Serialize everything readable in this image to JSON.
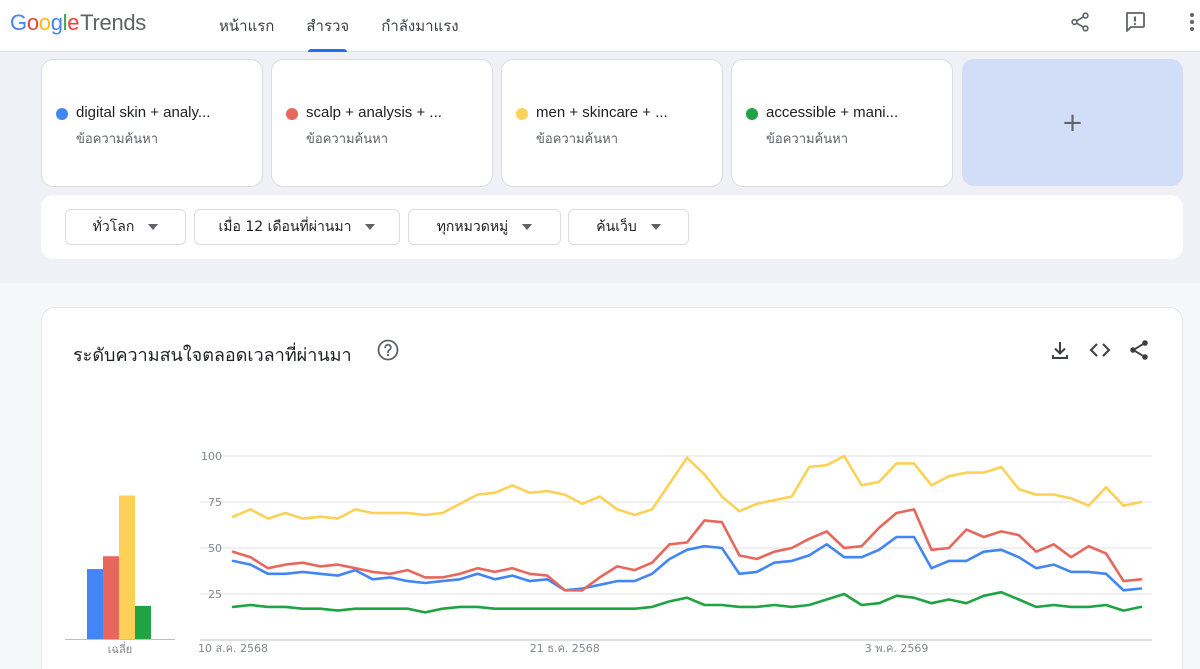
{
  "app": {
    "logo_google": [
      "G",
      "o",
      "o",
      "g",
      "l",
      "e"
    ],
    "logo_trends": "Trends"
  },
  "nav": {
    "tabs": [
      {
        "label": "หน้าแรก",
        "active": false
      },
      {
        "label": "สำรวจ",
        "active": true
      },
      {
        "label": "กำลังมาแรง",
        "active": false
      }
    ]
  },
  "header_icons": [
    "share-icon",
    "feedback-icon",
    "apps-icon"
  ],
  "terms": [
    {
      "name": "digital skin + analy...",
      "type": "ข้อความค้นหา",
      "color": "#4285f4"
    },
    {
      "name": "scalp + analysis + ...",
      "type": "ข้อความค้นหา",
      "color": "#e8675c"
    },
    {
      "name": "men + skincare + ...",
      "type": "ข้อความค้นหา",
      "color": "#fdd158"
    },
    {
      "name": "accessible + mani...",
      "type": "ข้อความค้นหา",
      "color": "#1fa343"
    }
  ],
  "add_term_label": "+",
  "filters": [
    {
      "label": "ทั่วโลก"
    },
    {
      "label": "เมื่อ 12 เดือนที่ผ่านมา"
    },
    {
      "label": "ทุกหมวดหมู่"
    },
    {
      "label": "ค้นเว็บ"
    }
  ],
  "panel": {
    "title": "ระดับความสนใจตลอดเวลาที่ผ่านมา",
    "icons": [
      "download-icon",
      "embed-icon",
      "share-icon"
    ]
  },
  "chart_data": {
    "type": "line",
    "ylim": [
      0,
      100
    ],
    "yticks": [
      "100",
      "75",
      "50",
      "25"
    ],
    "yticks_values": [
      100,
      75,
      50,
      25
    ],
    "grid": true,
    "xtick_labels": [
      {
        "label": "10 ส.ค. 2568",
        "index": 0
      },
      {
        "label": "21 ธ.ค. 2568",
        "index": 19
      },
      {
        "label": "3 พ.ค. 2569",
        "index": 38
      }
    ],
    "average": {
      "label": "เฉลี่ย",
      "values": [
        38,
        45,
        78,
        18
      ]
    },
    "series": [
      {
        "color": "#4285f4",
        "values": [
          43,
          41,
          36,
          36,
          37,
          36,
          35,
          38,
          33,
          34,
          32,
          31,
          32,
          33,
          36,
          33,
          35,
          32,
          33,
          27,
          28,
          30,
          32,
          32,
          36,
          44,
          49,
          51,
          50,
          36,
          37,
          42,
          43,
          46,
          52,
          45,
          45,
          49,
          56,
          56,
          39,
          43,
          43,
          48,
          49,
          45,
          39,
          41,
          37,
          37,
          36,
          27,
          28
        ]
      },
      {
        "color": "#e8675c",
        "values": [
          48,
          45,
          39,
          41,
          42,
          40,
          41,
          39,
          37,
          36,
          38,
          34,
          34,
          36,
          39,
          37,
          39,
          36,
          35,
          27,
          27,
          34,
          40,
          38,
          42,
          52,
          53,
          65,
          64,
          46,
          44,
          48,
          50,
          55,
          59,
          50,
          51,
          61,
          69,
          71,
          49,
          50,
          60,
          56,
          59,
          57,
          48,
          52,
          45,
          51,
          47,
          32,
          33
        ]
      },
      {
        "color": "#fdd158",
        "values": [
          67,
          71,
          66,
          69,
          66,
          67,
          66,
          71,
          69,
          69,
          69,
          68,
          69,
          74,
          79,
          80,
          84,
          80,
          81,
          79,
          74,
          78,
          71,
          68,
          71,
          85,
          99,
          90,
          78,
          70,
          74,
          76,
          78,
          94,
          95,
          100,
          84,
          86,
          96,
          96,
          84,
          89,
          91,
          91,
          94,
          82,
          79,
          79,
          77,
          73,
          83,
          73,
          75
        ]
      },
      {
        "color": "#1fa343",
        "values": [
          18,
          19,
          18,
          18,
          17,
          17,
          16,
          17,
          17,
          17,
          17,
          15,
          17,
          18,
          18,
          17,
          17,
          17,
          17,
          17,
          17,
          17,
          17,
          17,
          18,
          21,
          23,
          19,
          19,
          18,
          18,
          19,
          18,
          19,
          22,
          25,
          19,
          20,
          24,
          23,
          20,
          22,
          20,
          24,
          26,
          22,
          18,
          19,
          18,
          18,
          19,
          16,
          18
        ]
      }
    ]
  }
}
